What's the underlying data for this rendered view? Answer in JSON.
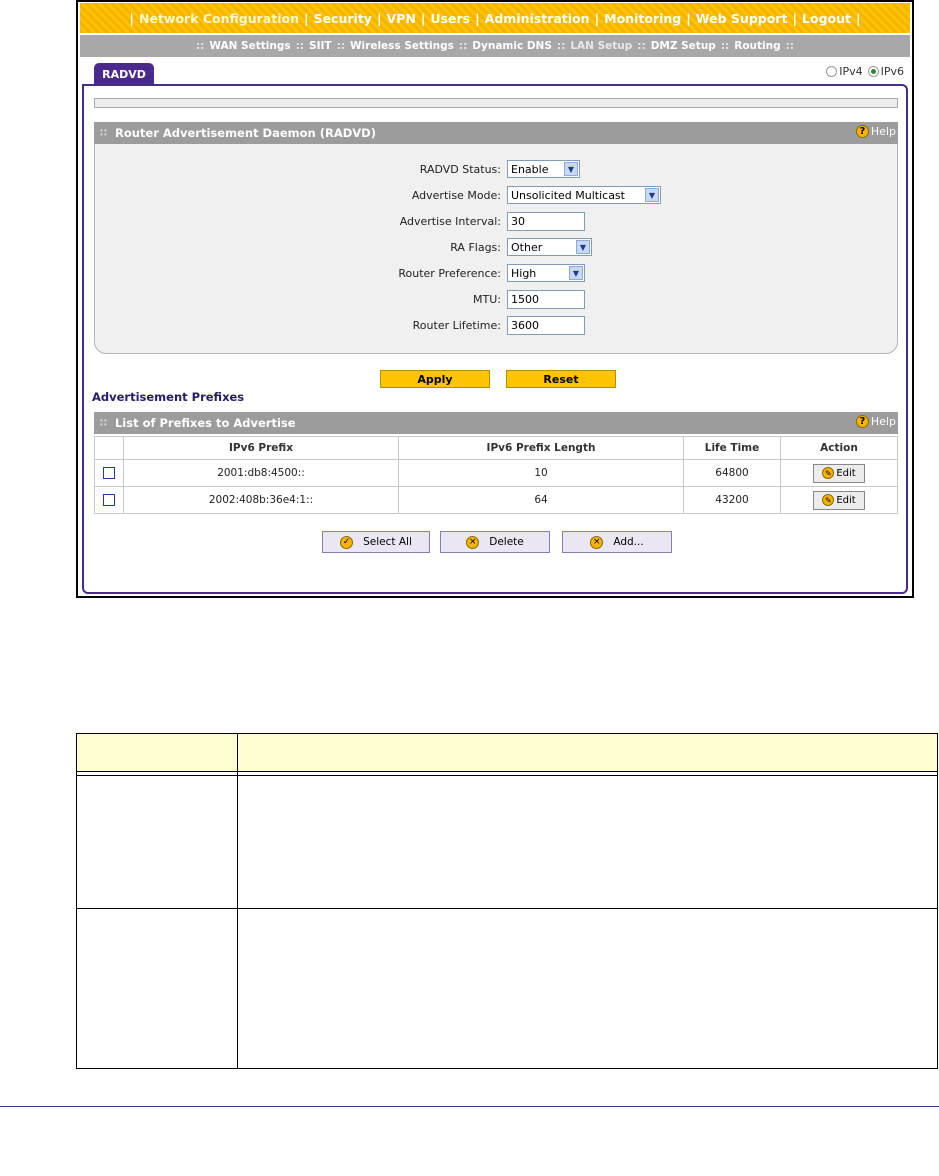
{
  "nav": {
    "items": [
      "Network Configuration",
      "Security",
      "VPN",
      "Users",
      "Administration",
      "Monitoring",
      "Web Support",
      "Logout"
    ],
    "active": "Network Configuration"
  },
  "subnav": {
    "items": [
      "WAN Settings",
      "SIIT",
      "Wireless Settings",
      "Dynamic DNS",
      "LAN Setup",
      "DMZ Setup",
      "Routing"
    ]
  },
  "tab": {
    "label": "RADVD"
  },
  "ip_version": {
    "ipv4": "IPv4",
    "ipv6": "IPv6",
    "selected": "IPv6"
  },
  "radvd_section": {
    "title": "Router Advertisement Daemon (RADVD)",
    "help": "Help",
    "fields": {
      "status": {
        "label": "RADVD Status:",
        "value": "Enable"
      },
      "mode": {
        "label": "Advertise Mode:",
        "value": "Unsolicited Multicast"
      },
      "interval": {
        "label": "Advertise Interval:",
        "value": "30"
      },
      "flags": {
        "label": "RA Flags:",
        "value": "Other"
      },
      "preference": {
        "label": "Router Preference:",
        "value": "High"
      },
      "mtu": {
        "label": "MTU:",
        "value": "1500"
      },
      "lifetime": {
        "label": "Router Lifetime:",
        "value": "3600"
      }
    }
  },
  "buttons": {
    "apply": "Apply",
    "reset": "Reset"
  },
  "prefixes": {
    "heading": "Advertisement Prefixes",
    "list_title": "List of Prefixes to Advertise",
    "help": "Help",
    "columns": [
      "IPv6 Prefix",
      "IPv6 Prefix Length",
      "Life Time",
      "Action"
    ],
    "rows": [
      {
        "prefix": "2001:db8:4500::",
        "length": "10",
        "lifetime": "64800",
        "action": "Edit"
      },
      {
        "prefix": "2002:408b:36e4:1::",
        "length": "64",
        "lifetime": "43200",
        "action": "Edit"
      }
    ]
  },
  "actions": {
    "select_all": "Select All",
    "delete": "Delete",
    "add": "Add..."
  },
  "colors": {
    "nav_bg": "#ffc400",
    "accent": "#4a2b8c",
    "section_bg": "#9c9c9c",
    "table_header_bg": "#ffffd0"
  }
}
